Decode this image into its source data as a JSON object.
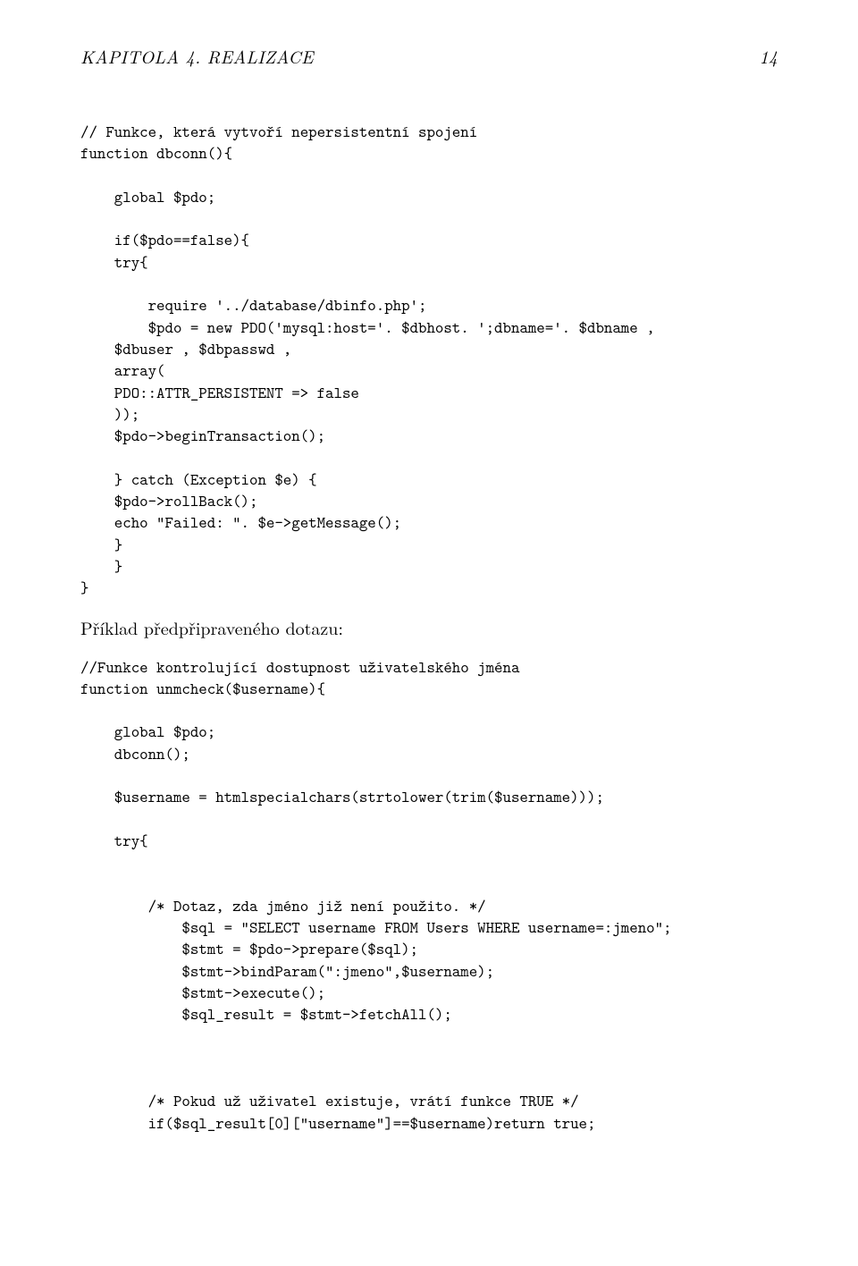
{
  "header": {
    "left": "KAPITOLA 4. REALIZACE",
    "right": "14"
  },
  "code_block_1": "// Funkce, která vytvoří nepersistentní spojení\nfunction dbconn(){\n\n    global $pdo;\n\n    if($pdo==false){\n    try{\n\n        require '../database/dbinfo.php';\n        $pdo = new PDO('mysql:host='. $dbhost. ';dbname='. $dbname ,\n    $dbuser , $dbpasswd ,\n    array(\n    PDO::ATTR_PERSISTENT => false\n    ));\n    $pdo->beginTransaction();\n\n    } catch (Exception $e) {\n    $pdo->rollBack();\n    echo \"Failed: \". $e->getMessage();\n    }\n    }\n}",
  "prose_1": "Příklad předpřipraveného dotazu:",
  "code_block_2": "//Funkce kontrolující dostupnost uživatelského jména\nfunction unmcheck($username){\n\n    global $pdo;\n    dbconn();\n\n    $username = htmlspecialchars(strtolower(trim($username)));\n\n    try{\n\n\n        /* Dotaz, zda jméno již není použito. */\n            $sql = \"SELECT username FROM Users WHERE username=:jmeno\";\n            $stmt = $pdo->prepare($sql);\n            $stmt->bindParam(\":jmeno\",$username);\n            $stmt->execute();\n            $sql_result = $stmt->fetchAll();\n\n\n\n        /* Pokud už uživatel existuje, vrátí funkce TRUE */\n        if($sql_result[0][\"username\"]==$username)return true;"
}
